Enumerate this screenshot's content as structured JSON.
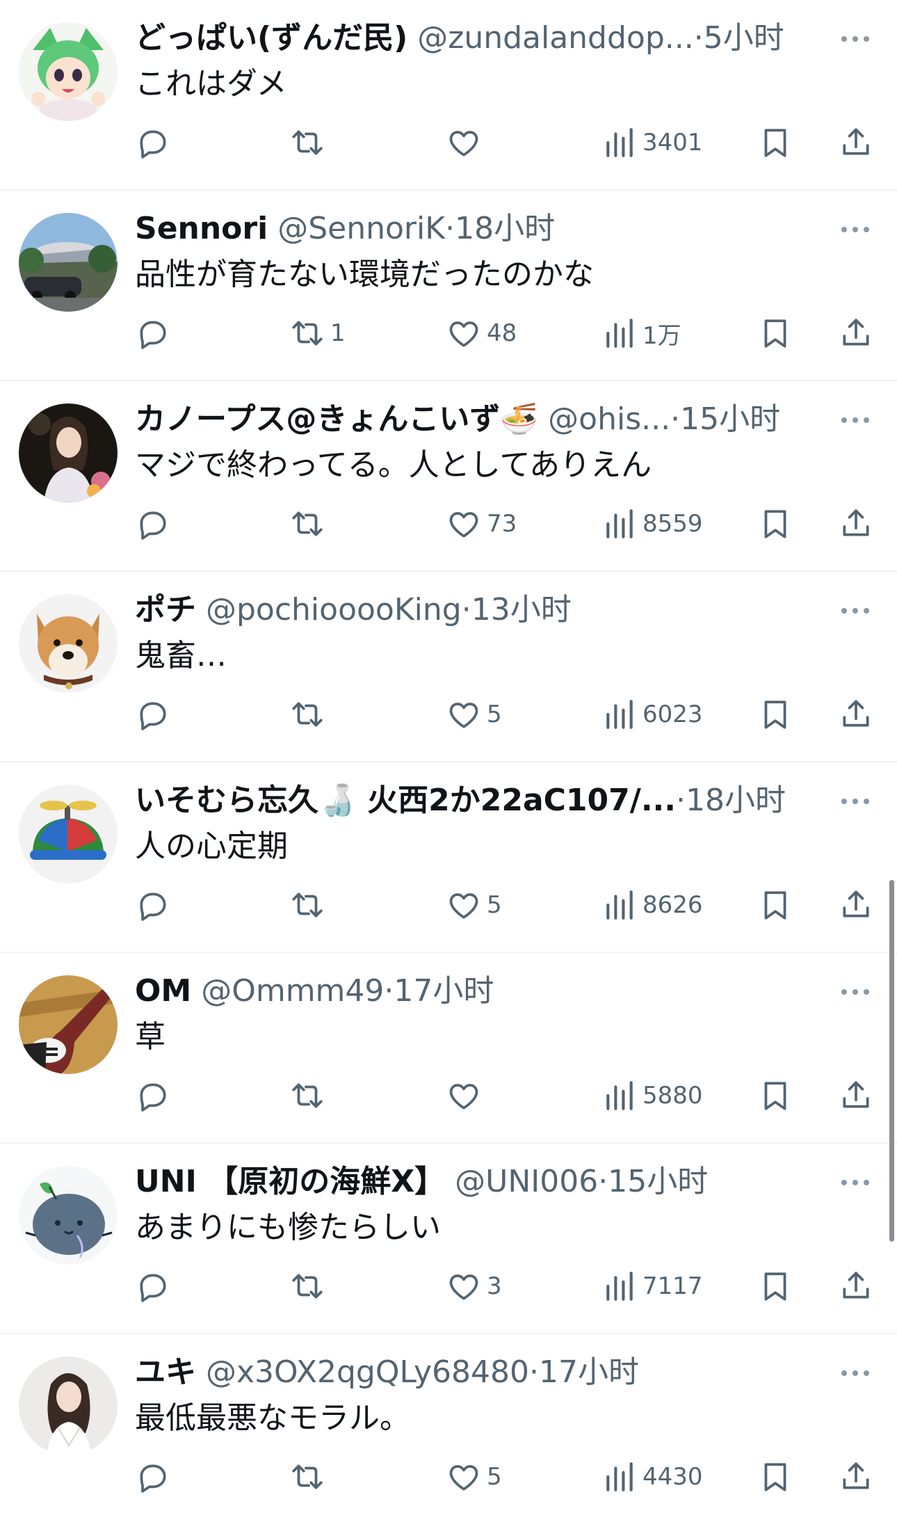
{
  "tweets": [
    {
      "name": "どっぱい(ずんだ民)",
      "handle": "@zundalanddop...",
      "time": "5小时",
      "text": "これはダメ",
      "replies": "",
      "retweets": "",
      "likes": "",
      "views": "3401"
    },
    {
      "name": "Sennori",
      "handle": "@SennoriK",
      "time": "18小时",
      "text": "品性が育たない環境だったのかな",
      "replies": "",
      "retweets": "1",
      "likes": "48",
      "views": "1万"
    },
    {
      "name": "カノープス@きょんこいず🍜",
      "handle": "@ohis...",
      "time": "15小时",
      "text": "マジで終わってる。人としてありえん",
      "replies": "",
      "retweets": "",
      "likes": "73",
      "views": "8559"
    },
    {
      "name": "ポチ",
      "handle": "@pochiooooKing",
      "time": "13小时",
      "text": "鬼畜…",
      "replies": "",
      "retweets": "",
      "likes": "5",
      "views": "6023"
    },
    {
      "name": "いそむら忘久🍶 火西2か22aC107/...",
      "handle": "",
      "time": "18小时",
      "text": "人の心定期",
      "replies": "",
      "retweets": "",
      "likes": "5",
      "views": "8626"
    },
    {
      "name": "OM",
      "handle": "@Ommm49",
      "time": "17小时",
      "text": "草",
      "replies": "",
      "retweets": "",
      "likes": "",
      "views": "5880"
    },
    {
      "name": "UNI 【原初の海鮮X】",
      "handle": "@UNI006",
      "time": "15小时",
      "text": "あまりにも惨たらしい",
      "replies": "",
      "retweets": "",
      "likes": "3",
      "views": "7117"
    },
    {
      "name": "ユキ",
      "handle": "@x3OX2qgQLy68480",
      "time": "17小时",
      "text": "最低最悪なモラル。",
      "replies": "",
      "retweets": "",
      "likes": "5",
      "views": "4430"
    }
  ],
  "separator": "·",
  "icons": {
    "reply": "reply-icon",
    "retweet": "retweet-icon",
    "like": "like-icon",
    "views": "views-icon",
    "bookmark": "bookmark-icon",
    "share": "share-icon",
    "more": "more-icon"
  },
  "colors": {
    "text": "#0f1419",
    "secondary": "#536471",
    "divider": "#eff3f4",
    "background": "#ffffff"
  }
}
